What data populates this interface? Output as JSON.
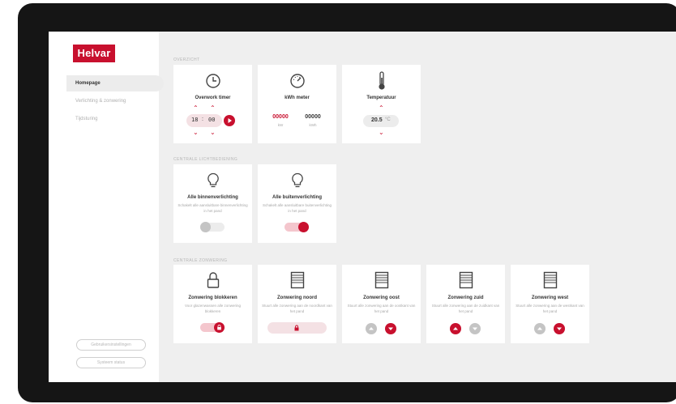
{
  "brand": {
    "logo": "Helvar",
    "accent": "#c8102e"
  },
  "sidebar": {
    "items": [
      {
        "label": "Homepage",
        "active": true
      },
      {
        "label": "Verlichting & zonwering",
        "active": false
      },
      {
        "label": "Tijdsturing",
        "active": false
      }
    ],
    "settings_button": "Gebruikersinstellingen",
    "logout_button": "Systeem status"
  },
  "sections": {
    "overview": "OVERZICHT",
    "lighting": "CENTRALE LICHTBEDIENING",
    "shading": "CENTRALE ZONWERING"
  },
  "overwork_timer": {
    "title": "Overwork timer",
    "hours": "18",
    "separator": ":",
    "minutes": "00",
    "icon": "clock-icon"
  },
  "kwh_meter": {
    "title": "kWh meter",
    "value1": "00000",
    "unit1": "kW",
    "value2": "00000",
    "unit2": "kWh",
    "icon": "gauge-icon"
  },
  "temperature": {
    "title": "Temperatuur",
    "value": "20.5",
    "unit": "°C",
    "icon": "thermometer-icon"
  },
  "lighting_cards": [
    {
      "title": "Alle binnenverlichting",
      "desc": "Schakelt alle aansluitbare binnenverlichting in het pand",
      "on": false,
      "icon": "lightbulb-icon"
    },
    {
      "title": "Alle buitenverlichting",
      "desc": "Schakelt alle aansluitbare buitenverlichting in het pand",
      "on": true,
      "icon": "lightbulb-icon"
    }
  ],
  "shading_cards": [
    {
      "title": "Zonwering blokkeren",
      "desc": "Voor glazenwassen alle zonwering blokkeren",
      "icon": "lock-icon"
    },
    {
      "title": "Zonwering noord",
      "desc": "Stuurt alle zonwering aan de noordkant van het pand",
      "icon": "blind-icon"
    },
    {
      "title": "Zonwering oost",
      "desc": "Stuurt alle zonwering aan de oostkant van het pand",
      "icon": "blind-icon"
    },
    {
      "title": "Zonwering zuid",
      "desc": "Stuurt alle zonwering aan de zuidkant van het pand",
      "icon": "blind-icon"
    },
    {
      "title": "Zonwering west",
      "desc": "Stuurt alle zonwering aan de westkant van het pand",
      "icon": "blind-icon"
    }
  ]
}
